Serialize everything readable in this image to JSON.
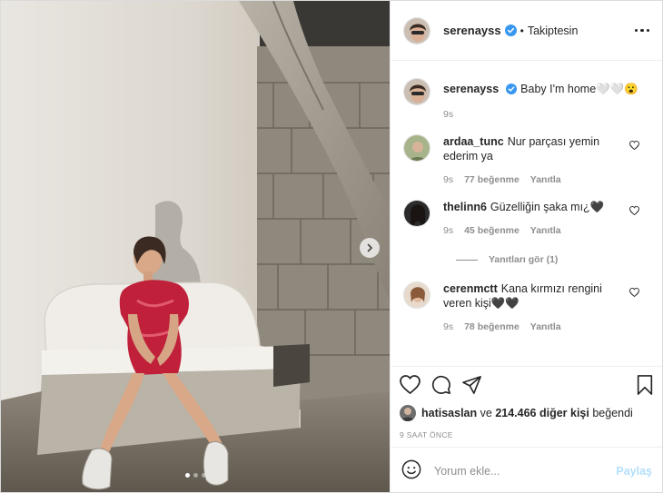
{
  "post": {
    "username": "serenayss",
    "separator": "•",
    "follow_status": "Takiptesin"
  },
  "caption": {
    "username": "serenayss",
    "text": "Baby I'm home🤍🤍😮",
    "time": "9s"
  },
  "comments": [
    {
      "username": "ardaa_tunc",
      "text": "Nur parçası yemin ederim ya",
      "time": "9s",
      "likes": "77 beğenme",
      "reply": "Yanıtla"
    },
    {
      "username": "thelinn6",
      "text": "Güzelliğin şaka mı¿🖤",
      "time": "9s",
      "likes": "45 beğenme",
      "reply": "Yanıtla"
    },
    {
      "username": "cerenmctt",
      "text": "Kana kırmızı rengini veren kişi🖤🖤",
      "time": "9s",
      "likes": "78 beğenme",
      "reply": "Yanıtla"
    }
  ],
  "view_replies": "Yanıtları gör (1)",
  "likes_line": {
    "user": "hatisaslan",
    "middle": "ve",
    "others": "214.466 diğer kişi",
    "suffix": "beğendi"
  },
  "time_ago": "9 SAAT ÖNCE",
  "add_comment": {
    "placeholder": "Yorum ekle...",
    "post_label": "Paylaş"
  },
  "carousel": {
    "current_slide": 1,
    "total_slides": 3
  },
  "colors": {
    "verified": "#3897f0",
    "post_button": "#b2dffc",
    "muted": "#8e8e8e",
    "dress": "#c0203a"
  },
  "icons": [
    "verified-icon",
    "more-options-icon",
    "heart-icon",
    "comment-icon",
    "share-icon",
    "bookmark-icon",
    "emoji-icon",
    "chevron-right-icon"
  ]
}
